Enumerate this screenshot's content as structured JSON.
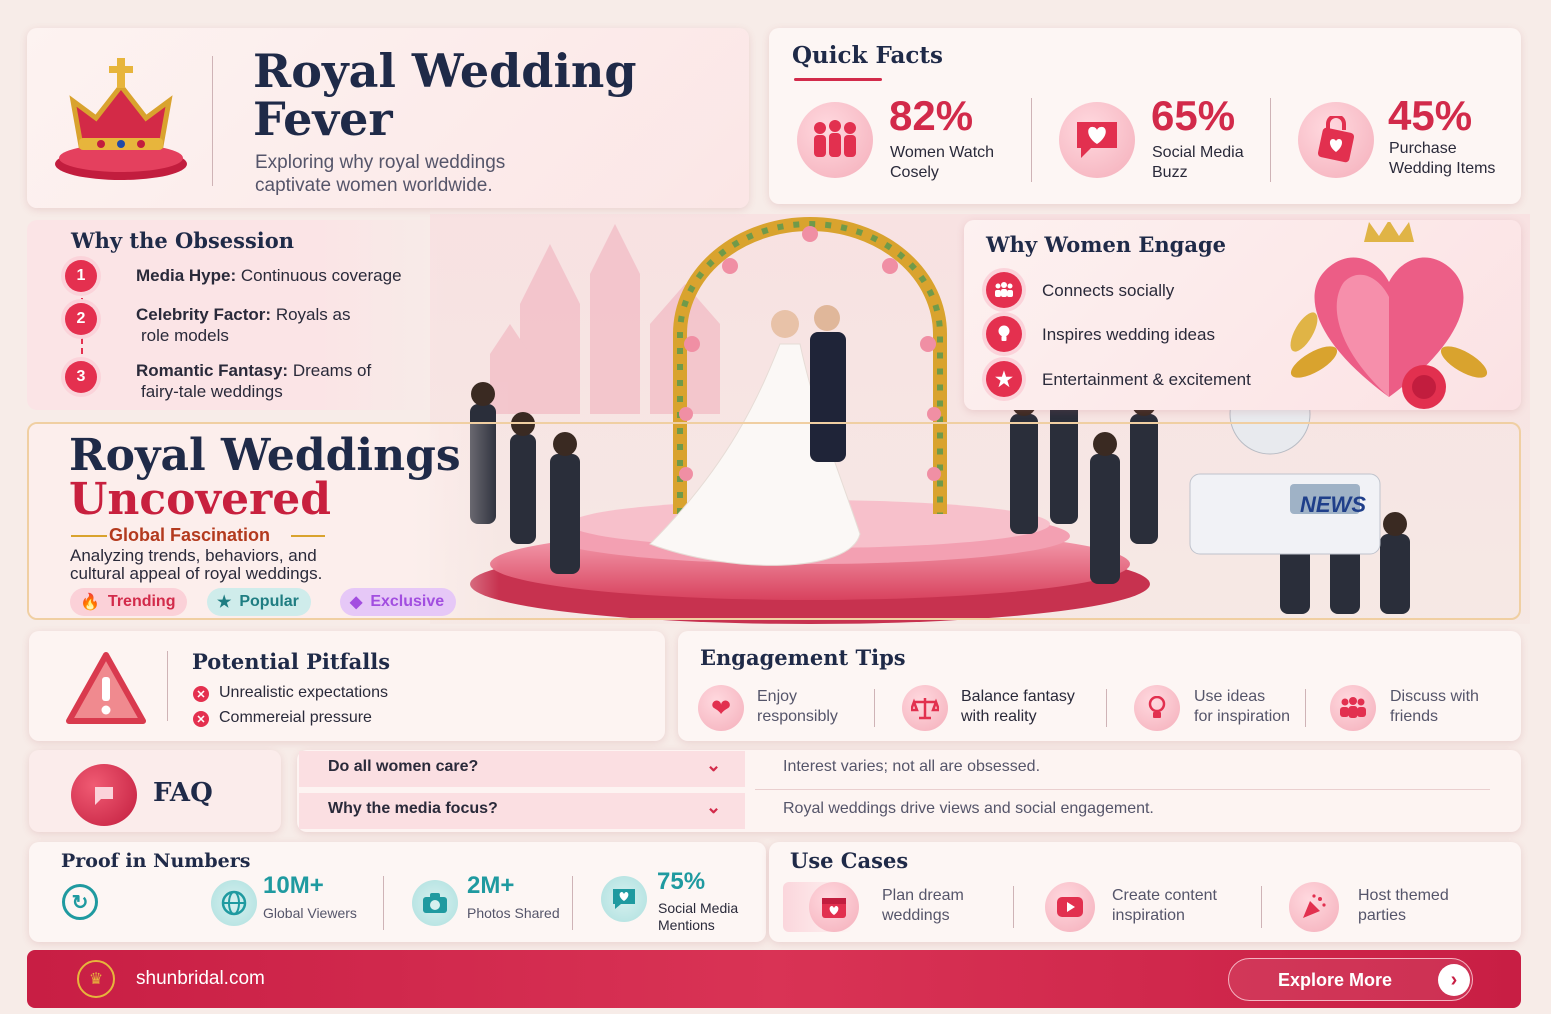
{
  "header": {
    "title_line1": "Royal Wedding",
    "title_line2": "Fever",
    "subtitle_line1": "Exploring why royal weddings",
    "subtitle_line2": "captivate women worldwide.",
    "crown_icon": "crown-icon"
  },
  "quick_facts": {
    "title": "Quick Facts",
    "items": [
      {
        "value": "82%",
        "label_line1": "Women Watch",
        "label_line2": "Cosely",
        "icon": "people-icon"
      },
      {
        "value": "65%",
        "label_line1": "Social Media",
        "label_line2": "Buzz",
        "icon": "heart-bubble-icon"
      },
      {
        "value": "45%",
        "label_line1": "Purchase",
        "label_line2": "Wedding Items",
        "icon": "shopping-bag-icon"
      }
    ]
  },
  "obsession": {
    "title": "Why the Obsession",
    "items": [
      {
        "num": "1",
        "bold": "Media Hype:",
        "text1": " Continuous coverage",
        "text2": ""
      },
      {
        "num": "2",
        "bold": "Celebrity Factor:",
        "text1": " Royals as",
        "text2": "role models"
      },
      {
        "num": "3",
        "bold": "Romantic Fantasy:",
        "text1": " Dreams of",
        "text2": "fairy-tale weddings"
      }
    ]
  },
  "engage": {
    "title": "Why Women Engage",
    "items": [
      {
        "label": "Connects socially",
        "icon": "group-icon"
      },
      {
        "label": "Inspires wedding ideas",
        "icon": "lightbulb-icon"
      },
      {
        "label": "Entertainment & excitement",
        "icon": "star-icon"
      }
    ]
  },
  "hero": {
    "title_line1": "Royal Weddings",
    "title_line2": "Uncovered",
    "kicker": "Global Fascination",
    "desc_line1": "Analyzing trends, behaviors, and",
    "desc_line2": "cultural appeal of royal weddings.",
    "tags": [
      {
        "label": "Trending",
        "icon": "flame-icon"
      },
      {
        "label": "Popular",
        "icon": "star-icon"
      },
      {
        "label": "Exclusive",
        "icon": "diamond-icon"
      }
    ],
    "news_label": "NEWS"
  },
  "pitfalls": {
    "title": "Potential Pitfalls",
    "items": [
      "Unrealistic expectations",
      "Commereial pressure"
    ]
  },
  "tips": {
    "title": "Engagement Tips",
    "items": [
      {
        "line1": "Enjoy",
        "line2": "responsibly",
        "icon": "heart-icon"
      },
      {
        "line1": "Balance fantasy",
        "line2": "with reality",
        "icon": "scales-icon"
      },
      {
        "line1": "Use ideas",
        "line2": "for inspiration",
        "icon": "lightbulb-icon"
      },
      {
        "line1": "Discuss with",
        "line2": "friends",
        "icon": "group-icon"
      }
    ]
  },
  "faq": {
    "title": "FAQ",
    "items": [
      {
        "q": "Do all women care?",
        "a": "Interest varies; not all are obsessed."
      },
      {
        "q": "Why the media focus?",
        "a": "Royal weddings drive views and social engagement."
      }
    ]
  },
  "proof": {
    "title": "Proof in Numbers",
    "items": [
      {
        "value": "10M+",
        "line1": "Global Viewers",
        "line2": "",
        "icon": "globe-icon"
      },
      {
        "value": "2M+",
        "line1": "Photos Shared",
        "line2": "",
        "icon": "camera-icon"
      },
      {
        "value": "75%",
        "line1": "Social Media",
        "line2": "Mentions",
        "icon": "heart-bubble-icon"
      }
    ]
  },
  "use_cases": {
    "title": "Use Cases",
    "items": [
      {
        "line1": "Plan dream",
        "line2": "weddings",
        "icon": "calendar-heart-icon"
      },
      {
        "line1": "Create content",
        "line2": "inspiration",
        "icon": "play-icon"
      },
      {
        "line1": "Host themed",
        "line2": "parties",
        "icon": "party-popper-icon"
      }
    ]
  },
  "footer": {
    "site": "shunbridal.com",
    "cta": "Explore More"
  },
  "colors": {
    "accent": "#d22a4a",
    "navy": "#1f2a48",
    "teal": "#1f9aa0",
    "purple": "#a24ee0"
  }
}
